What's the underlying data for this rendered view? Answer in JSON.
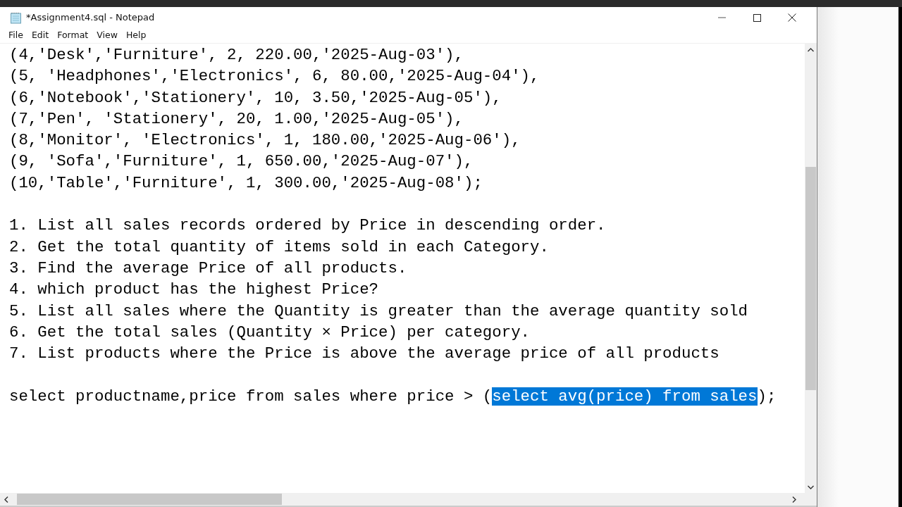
{
  "window": {
    "title": "*Assignment4.sql - Notepad"
  },
  "menu": [
    {
      "label": "File"
    },
    {
      "label": "Edit"
    },
    {
      "label": "Format"
    },
    {
      "label": "View"
    },
    {
      "label": "Help"
    }
  ],
  "editor": {
    "lines": [
      {
        "kind": "text",
        "segments": [
          {
            "text": "(4,'Desk','Furniture', 2, 220.00,'2025-Aug-03'),",
            "selected": false
          }
        ]
      },
      {
        "kind": "text",
        "segments": [
          {
            "text": "(5, 'Headphones','Electronics', 6, 80.00,'2025-Aug-04'),",
            "selected": false
          }
        ]
      },
      {
        "kind": "text",
        "segments": [
          {
            "text": "(6,'Notebook','Stationery', 10, 3.50,'2025-Aug-05'),",
            "selected": false
          }
        ]
      },
      {
        "kind": "text",
        "segments": [
          {
            "text": "(7,'Pen', 'Stationery', 20, 1.00,'2025-Aug-05'),",
            "selected": false
          }
        ]
      },
      {
        "kind": "text",
        "segments": [
          {
            "text": "(8,'Monitor', 'Electronics', 1, 180.00,'2025-Aug-06'),",
            "selected": false
          }
        ]
      },
      {
        "kind": "text",
        "segments": [
          {
            "text": "(9, 'Sofa','Furniture', 1, 650.00,'2025-Aug-07'),",
            "selected": false
          }
        ]
      },
      {
        "kind": "text",
        "segments": [
          {
            "text": "(10,'Table','Furniture', 1, 300.00,'2025-Aug-08');",
            "selected": false
          }
        ]
      },
      {
        "kind": "blank"
      },
      {
        "kind": "text",
        "segments": [
          {
            "text": "1. List all sales records ordered by Price in descending order.",
            "selected": false
          }
        ]
      },
      {
        "kind": "text",
        "segments": [
          {
            "text": "2. Get the total quantity of items sold in each Category.",
            "selected": false
          }
        ]
      },
      {
        "kind": "text",
        "segments": [
          {
            "text": "3. Find the average Price of all products.",
            "selected": false
          }
        ]
      },
      {
        "kind": "text",
        "segments": [
          {
            "text": "4. which product has the highest Price?",
            "selected": false
          }
        ]
      },
      {
        "kind": "text",
        "segments": [
          {
            "text": "5. List all sales where the Quantity is greater than the average quantity sold",
            "selected": false
          }
        ]
      },
      {
        "kind": "text",
        "segments": [
          {
            "text": "6. Get the total sales (Quantity × Price) per category.",
            "selected": false
          }
        ]
      },
      {
        "kind": "text",
        "segments": [
          {
            "text": "7. List products where the Price is above the average price of all products",
            "selected": false
          }
        ]
      },
      {
        "kind": "blank"
      },
      {
        "kind": "text",
        "segments": [
          {
            "text": "select productname,price from sales where price > (",
            "selected": false
          },
          {
            "text": "select avg(price) from sales",
            "selected": true
          },
          {
            "text": ");",
            "selected": false
          }
        ]
      }
    ]
  }
}
